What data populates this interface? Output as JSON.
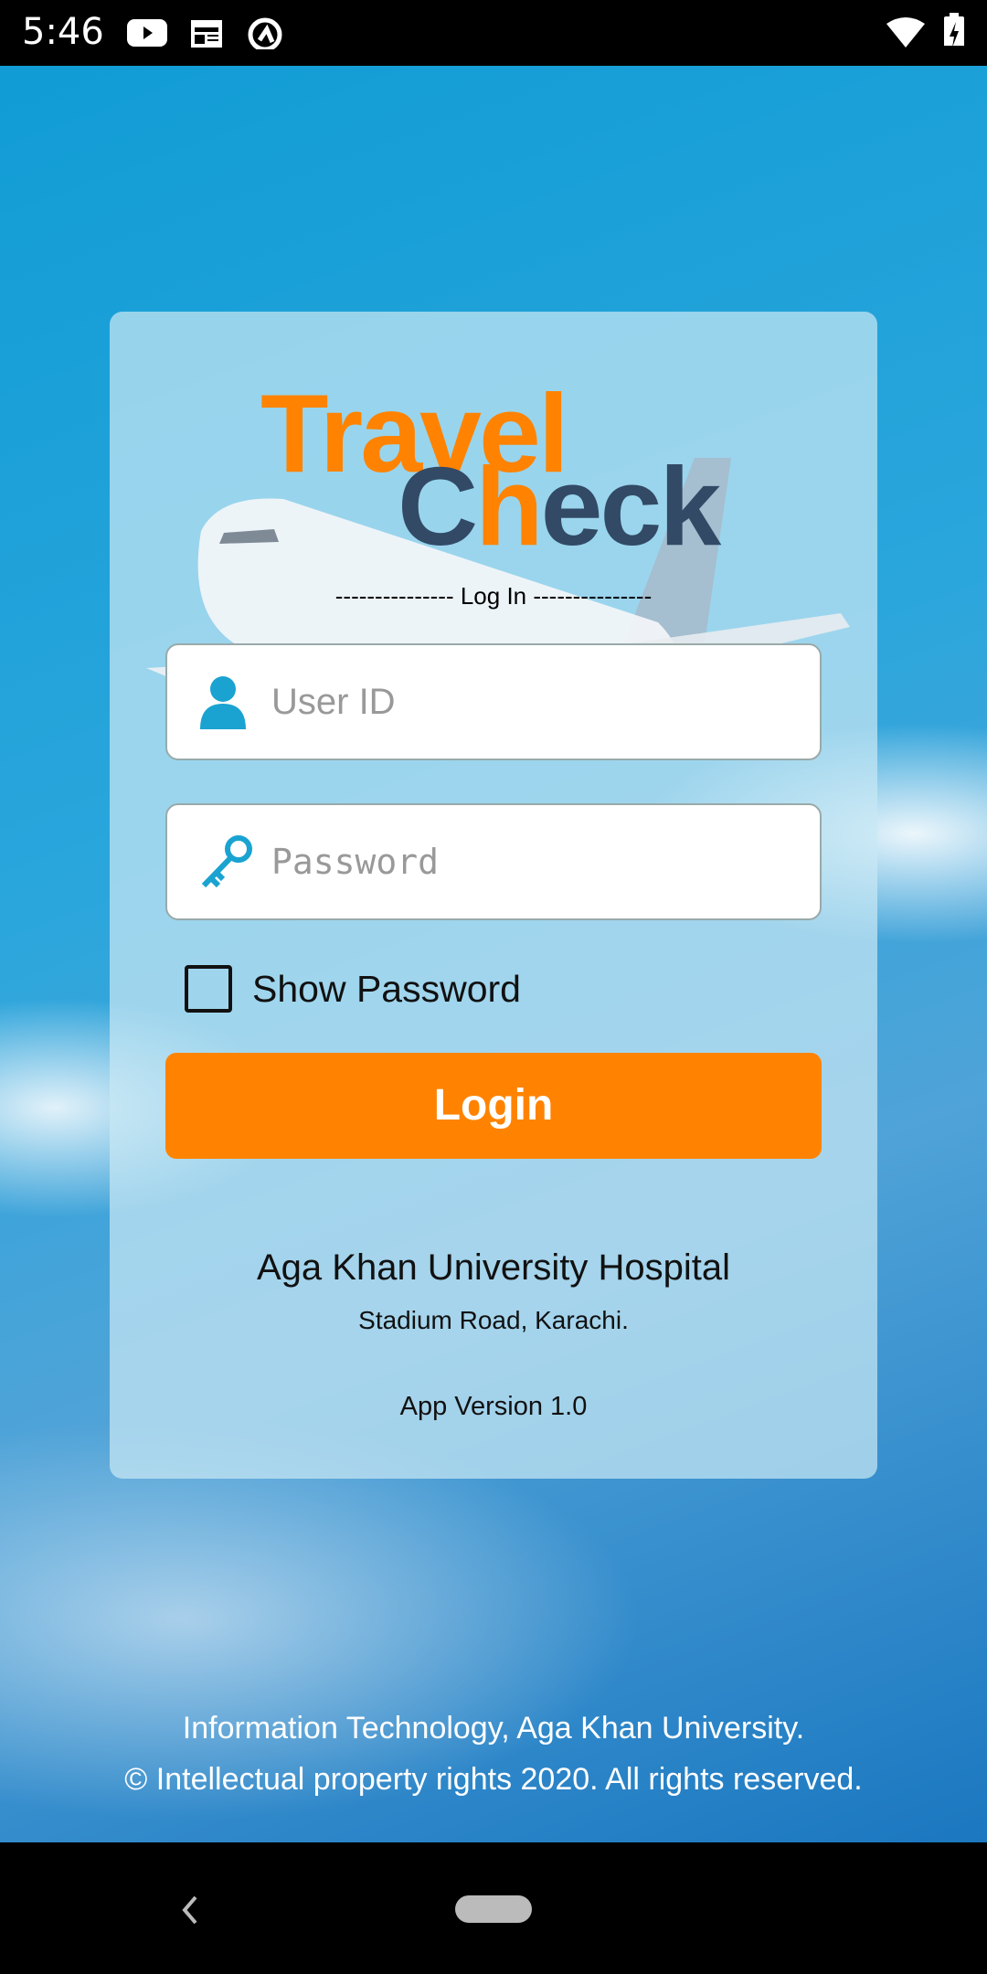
{
  "status_bar": {
    "time": "5:46",
    "icons": [
      "youtube-icon",
      "news-icon",
      "q-icon",
      "wifi-icon",
      "battery-charging-icon"
    ]
  },
  "logo": {
    "line1": "Travel",
    "line2_a": "C",
    "line2_b": "h",
    "line2_c": "eck"
  },
  "login_header": "--------------- Log In ---------------",
  "user_field": {
    "placeholder": "User ID",
    "value": ""
  },
  "password_field": {
    "placeholder": "Password",
    "value": ""
  },
  "show_password": {
    "label": "Show Password",
    "checked": false
  },
  "login_button": "Login",
  "org": {
    "name": "Aga Khan University Hospital",
    "address": "Stadium Road, Karachi."
  },
  "app_version": "App Version 1.0",
  "footer": {
    "line1": "Information Technology, Aga Khan University.",
    "line2": "© Intellectual property rights 2020. All rights reserved."
  },
  "colors": {
    "accent": "#ff8300",
    "logo_dark": "#324a66",
    "icon": "#1aa3d1"
  }
}
